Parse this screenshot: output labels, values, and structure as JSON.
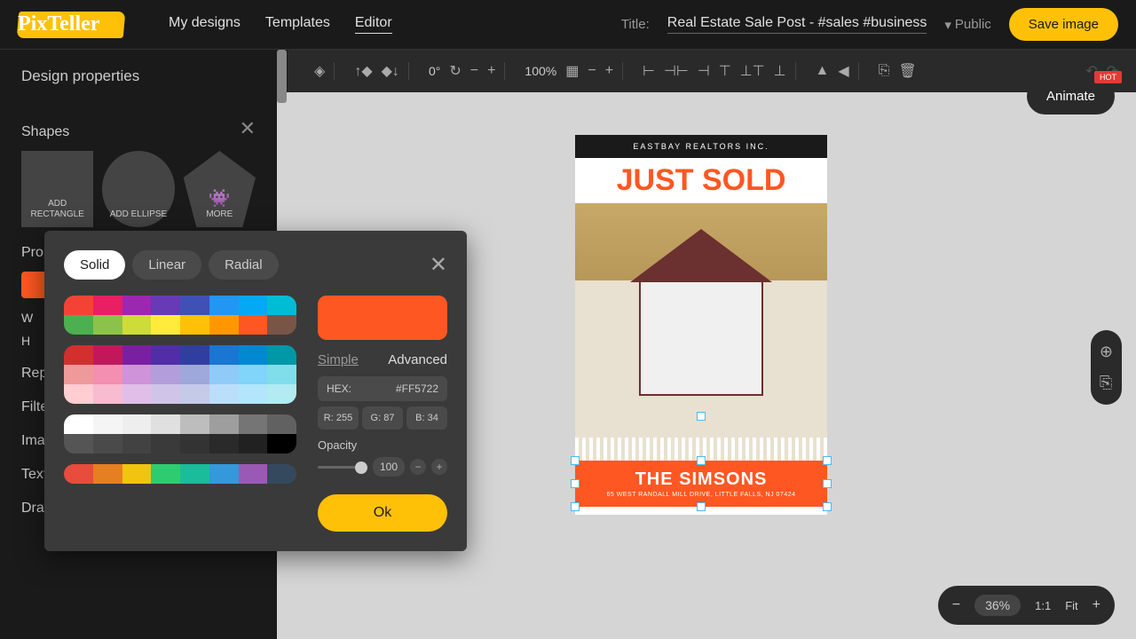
{
  "header": {
    "logo": "PixTeller",
    "nav": {
      "designs": "My designs",
      "templates": "Templates",
      "editor": "Editor"
    },
    "title_label": "Title:",
    "title_value": "Real Estate Sale Post - #sales #business",
    "visibility": "Public",
    "save": "Save image"
  },
  "sidebar": {
    "design_props": "Design properties",
    "shapes": "Shapes",
    "props_section": "Props",
    "repeat": "Repeat",
    "filters": "Filters",
    "image": "Image",
    "text": "Text",
    "drawing": "Drawing",
    "add_rect": "ADD RECTANGLE",
    "add_ellipse": "ADD ELLIPSE",
    "more": "MORE",
    "w_label": "W",
    "h_label": "H"
  },
  "toolbar": {
    "rotation": "0°",
    "zoom": "100%"
  },
  "canvas": {
    "company": "EASTBAY REALTORS INC.",
    "headline": "JUST SOLD",
    "name": "THE SIMSONS",
    "address": "65 WEST RANDALL MILL DRIVE, LITTLE FALLS, NJ 07424"
  },
  "animate": {
    "label": "Animate",
    "badge": "HOT"
  },
  "zoombar": {
    "value": "36%",
    "one": "1:1",
    "fit": "Fit"
  },
  "colorpicker": {
    "tabs": {
      "solid": "Solid",
      "linear": "Linear",
      "radial": "Radial"
    },
    "simple": "Simple",
    "advanced": "Advanced",
    "hex_label": "HEX:",
    "hex_value": "#FF5722",
    "r_label": "R:",
    "r_val": "255",
    "g_label": "G:",
    "g_val": "87",
    "b_label": "B:",
    "b_val": "34",
    "opacity_label": "Opacity",
    "opacity_value": "100",
    "ok": "Ok"
  }
}
